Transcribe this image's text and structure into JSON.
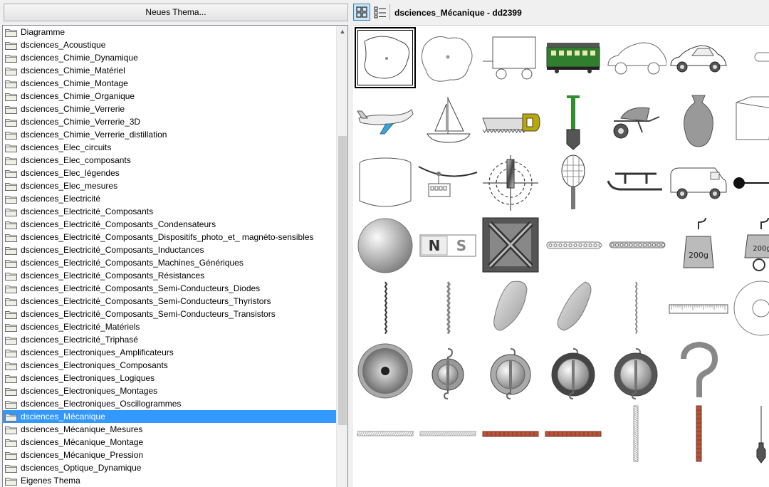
{
  "left_pane": {
    "new_theme_button": "Neues Thema...",
    "themes": [
      "Diagramme",
      "dsciences_Acoustique",
      "dsciences_Chimie_Dynamique",
      "dsciences_Chimie_Matériel",
      "dsciences_Chimie_Montage",
      "dsciences_Chimie_Organique",
      "dsciences_Chimie_Verrerie",
      "dsciences_Chimie_Verrerie_3D",
      "dsciences_Chimie_Verrerie_distillation",
      "dsciences_Elec_circuits",
      "dsciences_Elec_composants",
      "dsciences_Elec_légendes",
      "dsciences_Elec_mesures",
      "dsciences_Electricité",
      "dsciences_Electricité_Composants",
      "dsciences_Electricité_Composants_Condensateurs",
      "dsciences_Electricité_Composants_Dispositifs_photo_et_ magnéto-sensibles",
      "dsciences_Electricité_Composants_Inductances",
      "dsciences_Electricité_Composants_Machines_Génériques",
      "dsciences_Electricité_Composants_Résistances",
      "dsciences_Electricité_Composants_Semi-Conducteurs_Diodes",
      "dsciences_Electricité_Composants_Semi-Conducteurs_Thyristors",
      "dsciences_Electricité_Composants_Semi-Conducteurs_Transistors",
      "dsciences_Electricité_Matériels",
      "dsciences_Electricité_Triphasé",
      "dsciences_Electroniques_Amplificateurs",
      "dsciences_Electroniques_Composants",
      "dsciences_Electroniques_Logiques",
      "dsciences_Electroniques_Montages",
      "dsciences_Electroniques_Oscillogrammes",
      "dsciences_Mécanique",
      "dsciences_Mécanique_Mesures",
      "dsciences_Mécanique_Montage",
      "dsciences_Mécanique_Pression",
      "dsciences_Optique_Dynamique",
      "Eigenes Thema"
    ],
    "selected_theme": "dsciences_Mécanique"
  },
  "toolbar": {
    "title": "dsciences_Mécanique - dd2399",
    "view_icon_active": "grid-view-icon",
    "view_icon_alt": "list-view-icon"
  },
  "gallery": {
    "items": [
      {
        "name": "blob-with-pivot"
      },
      {
        "name": "blob-shape"
      },
      {
        "name": "wagon-outline"
      },
      {
        "name": "green-railway-car"
      },
      {
        "name": "car-outline"
      },
      {
        "name": "car"
      },
      {
        "name": "bullet"
      },
      {
        "name": "airplane"
      },
      {
        "name": "sailboat"
      },
      {
        "name": "saw"
      },
      {
        "name": "shovel"
      },
      {
        "name": "wheelbarrow"
      },
      {
        "name": "sandbag"
      },
      {
        "name": "box-3d"
      },
      {
        "name": "cylinder"
      },
      {
        "name": "cable-car"
      },
      {
        "name": "target-crosshair"
      },
      {
        "name": "tennis-racket"
      },
      {
        "name": "sled"
      },
      {
        "name": "van"
      },
      {
        "name": "pendulum"
      },
      {
        "name": "sphere"
      },
      {
        "name": "magnet-ns"
      },
      {
        "name": "metal-crate"
      },
      {
        "name": "chain-horizontal"
      },
      {
        "name": "chain-horizontal-2"
      },
      {
        "name": "mass-200g"
      },
      {
        "name": "mass-200g-2"
      },
      {
        "name": "spring-vertical"
      },
      {
        "name": "twisted-rope"
      },
      {
        "name": "wedge-left"
      },
      {
        "name": "wedge-right"
      },
      {
        "name": "rope-vertical"
      },
      {
        "name": "ruler"
      },
      {
        "name": "disc-outline"
      },
      {
        "name": "disc-grey"
      },
      {
        "name": "pulley-small"
      },
      {
        "name": "pulley-medium"
      },
      {
        "name": "pulley-dark"
      },
      {
        "name": "pulley-large"
      },
      {
        "name": "hook-large"
      },
      {
        "name": "hook-partial"
      },
      {
        "name": "ground-hatched"
      },
      {
        "name": "ground-hatched-2"
      },
      {
        "name": "brick-surface"
      },
      {
        "name": "brick-surface-2"
      },
      {
        "name": "wall-hatched"
      },
      {
        "name": "brick-wall"
      },
      {
        "name": "plumb-bob"
      }
    ],
    "labels": {
      "mass": "200g",
      "magnet_n": "N",
      "magnet_s": "S"
    }
  }
}
